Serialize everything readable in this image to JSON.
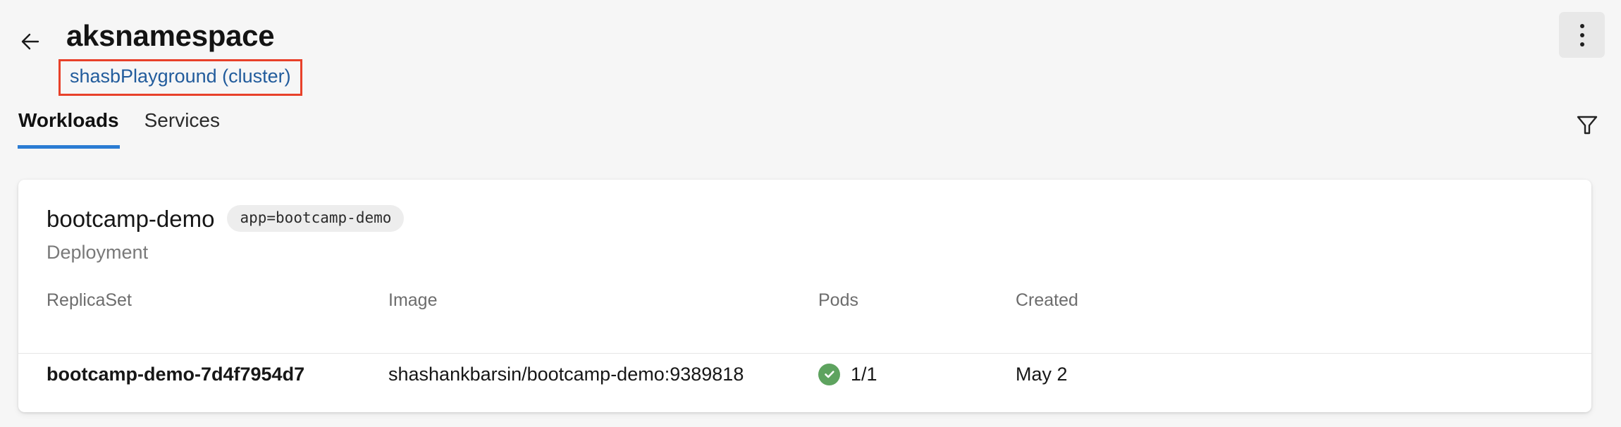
{
  "header": {
    "back_icon": "arrow-left-icon",
    "title": "aksnamespace",
    "cluster_link": "shasbPlayground (cluster)",
    "menu_icon": "kebab-menu-icon",
    "highlight_color": "#e8412a",
    "link_color": "#225c9c"
  },
  "tabs": {
    "items": [
      {
        "label": "Workloads",
        "active": true
      },
      {
        "label": "Services",
        "active": false
      }
    ],
    "active_underline_color": "#2b7cd3",
    "filter_icon": "filter-funnel-icon"
  },
  "card": {
    "title": "bootcamp-demo",
    "label_badge": "app=bootcamp-demo",
    "kind": "Deployment",
    "table": {
      "columns": [
        "ReplicaSet",
        "Image",
        "Pods",
        "Created"
      ],
      "rows": [
        {
          "replicaset": "bootcamp-demo-7d4f7954d7",
          "image": "shashankbarsin/bootcamp-demo:9389818",
          "pods": "1/1",
          "pods_status_icon": "check-circle-icon",
          "pods_status_color": "#5ea35f",
          "created": "May 2"
        }
      ]
    }
  }
}
